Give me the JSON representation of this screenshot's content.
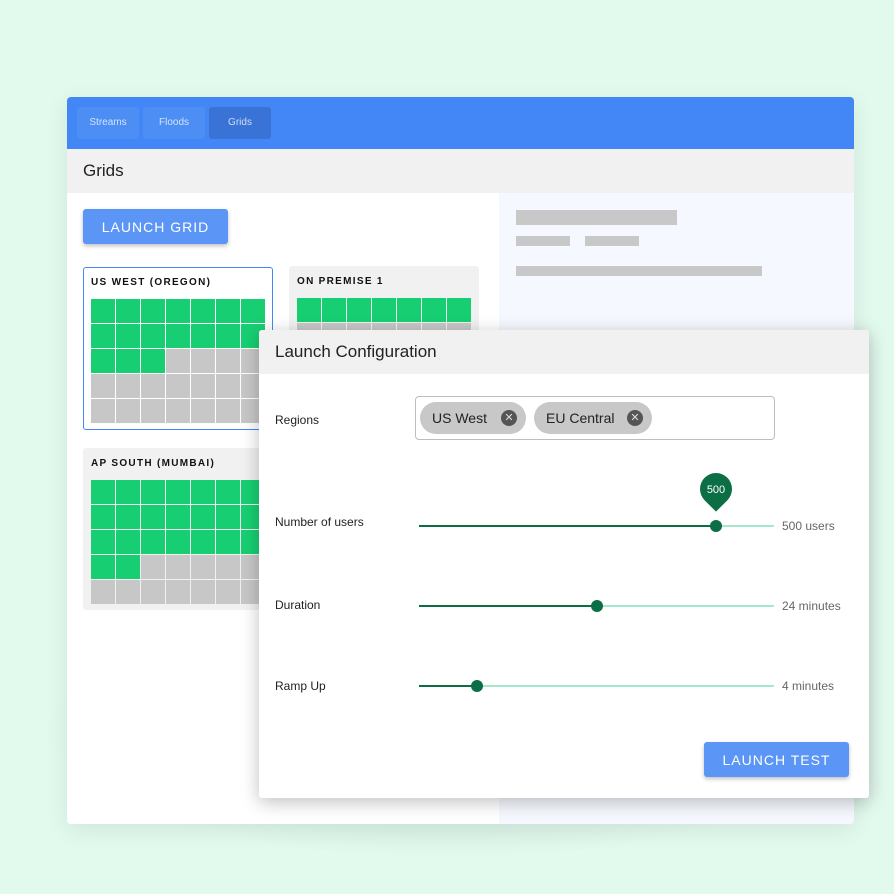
{
  "nav": {
    "tabs": [
      {
        "label": "Streams"
      },
      {
        "label": "Floods"
      },
      {
        "label": "Grids"
      }
    ],
    "active_tab": "Grids"
  },
  "page": {
    "title": "Grids",
    "launch_grid_label": "LAUNCH GRID"
  },
  "grids": [
    {
      "name": "US WEST (OREGON)",
      "active_cells": 17,
      "total_cells": 35
    },
    {
      "name": "ON PREMISE 1",
      "active_cells": 7,
      "total_cells": 14
    },
    {
      "name": "AP SOUTH (MUMBAI)",
      "active_cells": 23,
      "total_cells": 35
    }
  ],
  "dialog": {
    "title": "Launch Configuration",
    "regions_label": "Regions",
    "regions": [
      {
        "name": "US West"
      },
      {
        "name": "EU Central"
      }
    ],
    "sliders": [
      {
        "label": "Number of users",
        "value_text": "500 users",
        "pin_text": "500",
        "fraction": 0.836
      },
      {
        "label": "Duration",
        "value_text": "24 minutes",
        "fraction": 0.5
      },
      {
        "label": "Ramp Up",
        "value_text": "4 minutes",
        "fraction": 0.163
      }
    ],
    "launch_test_label": "LAUNCH TEST"
  },
  "colors": {
    "header_blue": "#4287f5",
    "button_blue": "#5b95f5",
    "active_cell": "#17cf72",
    "inactive_cell": "#c7c7c7",
    "slider_dark": "#0b6e44",
    "slider_light": "#a6e8cb",
    "background": "#e2f9ee"
  },
  "icons": {
    "chip_remove": "close-circle-icon"
  }
}
